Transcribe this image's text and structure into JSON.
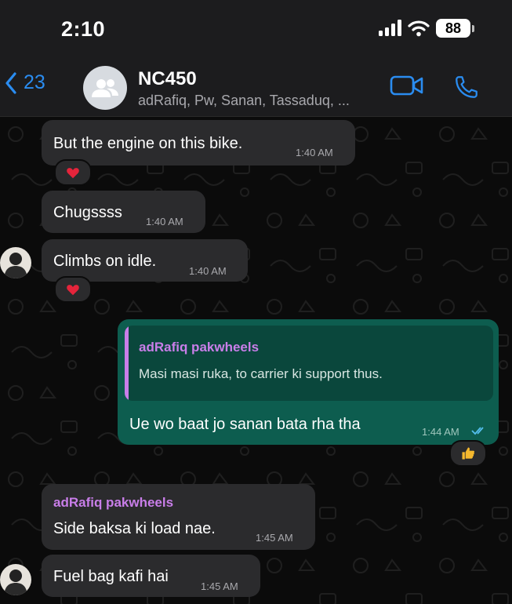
{
  "status_bar": {
    "time": "2:10",
    "battery": "88"
  },
  "header": {
    "back_count": "23",
    "group_name": "NC450",
    "members": "adRafiq, Pw, Sanan, Tassaduq, ..."
  },
  "messages": [
    {
      "text": "But the engine on this bike.",
      "time": "1:40 AM",
      "reaction": "heart"
    },
    {
      "text": "Chugssss",
      "time": "1:40 AM"
    },
    {
      "text": "Climbs on idle.",
      "time": "1:40 AM",
      "reaction": "heart"
    },
    {
      "quote_sender": "adRafiq pakwheels",
      "quote_text": "Masi masi ruka, to carrier ki support thus.",
      "text": "Ue wo baat jo sanan bata rha tha",
      "time": "1:44 AM",
      "status": "read",
      "reaction": "thumbs-up"
    },
    {
      "sender": "adRafiq pakwheels",
      "text": "Side baksa ki load nae.",
      "time": "1:45 AM"
    },
    {
      "text": "Fuel bag kafi hai",
      "time": "1:45 AM"
    }
  ],
  "colors": {
    "accent": "#2a8cf0",
    "outgoing_bubble": "#0d5d4f",
    "incoming_bubble": "#2b2b2d",
    "sender_name": "#c97ee9"
  },
  "icons": [
    "back-chevron-icon",
    "group-icon",
    "video-icon",
    "phone-icon",
    "heart-icon",
    "thumbs-up-icon",
    "double-check-icon",
    "signal-icon",
    "wifi-icon"
  ]
}
